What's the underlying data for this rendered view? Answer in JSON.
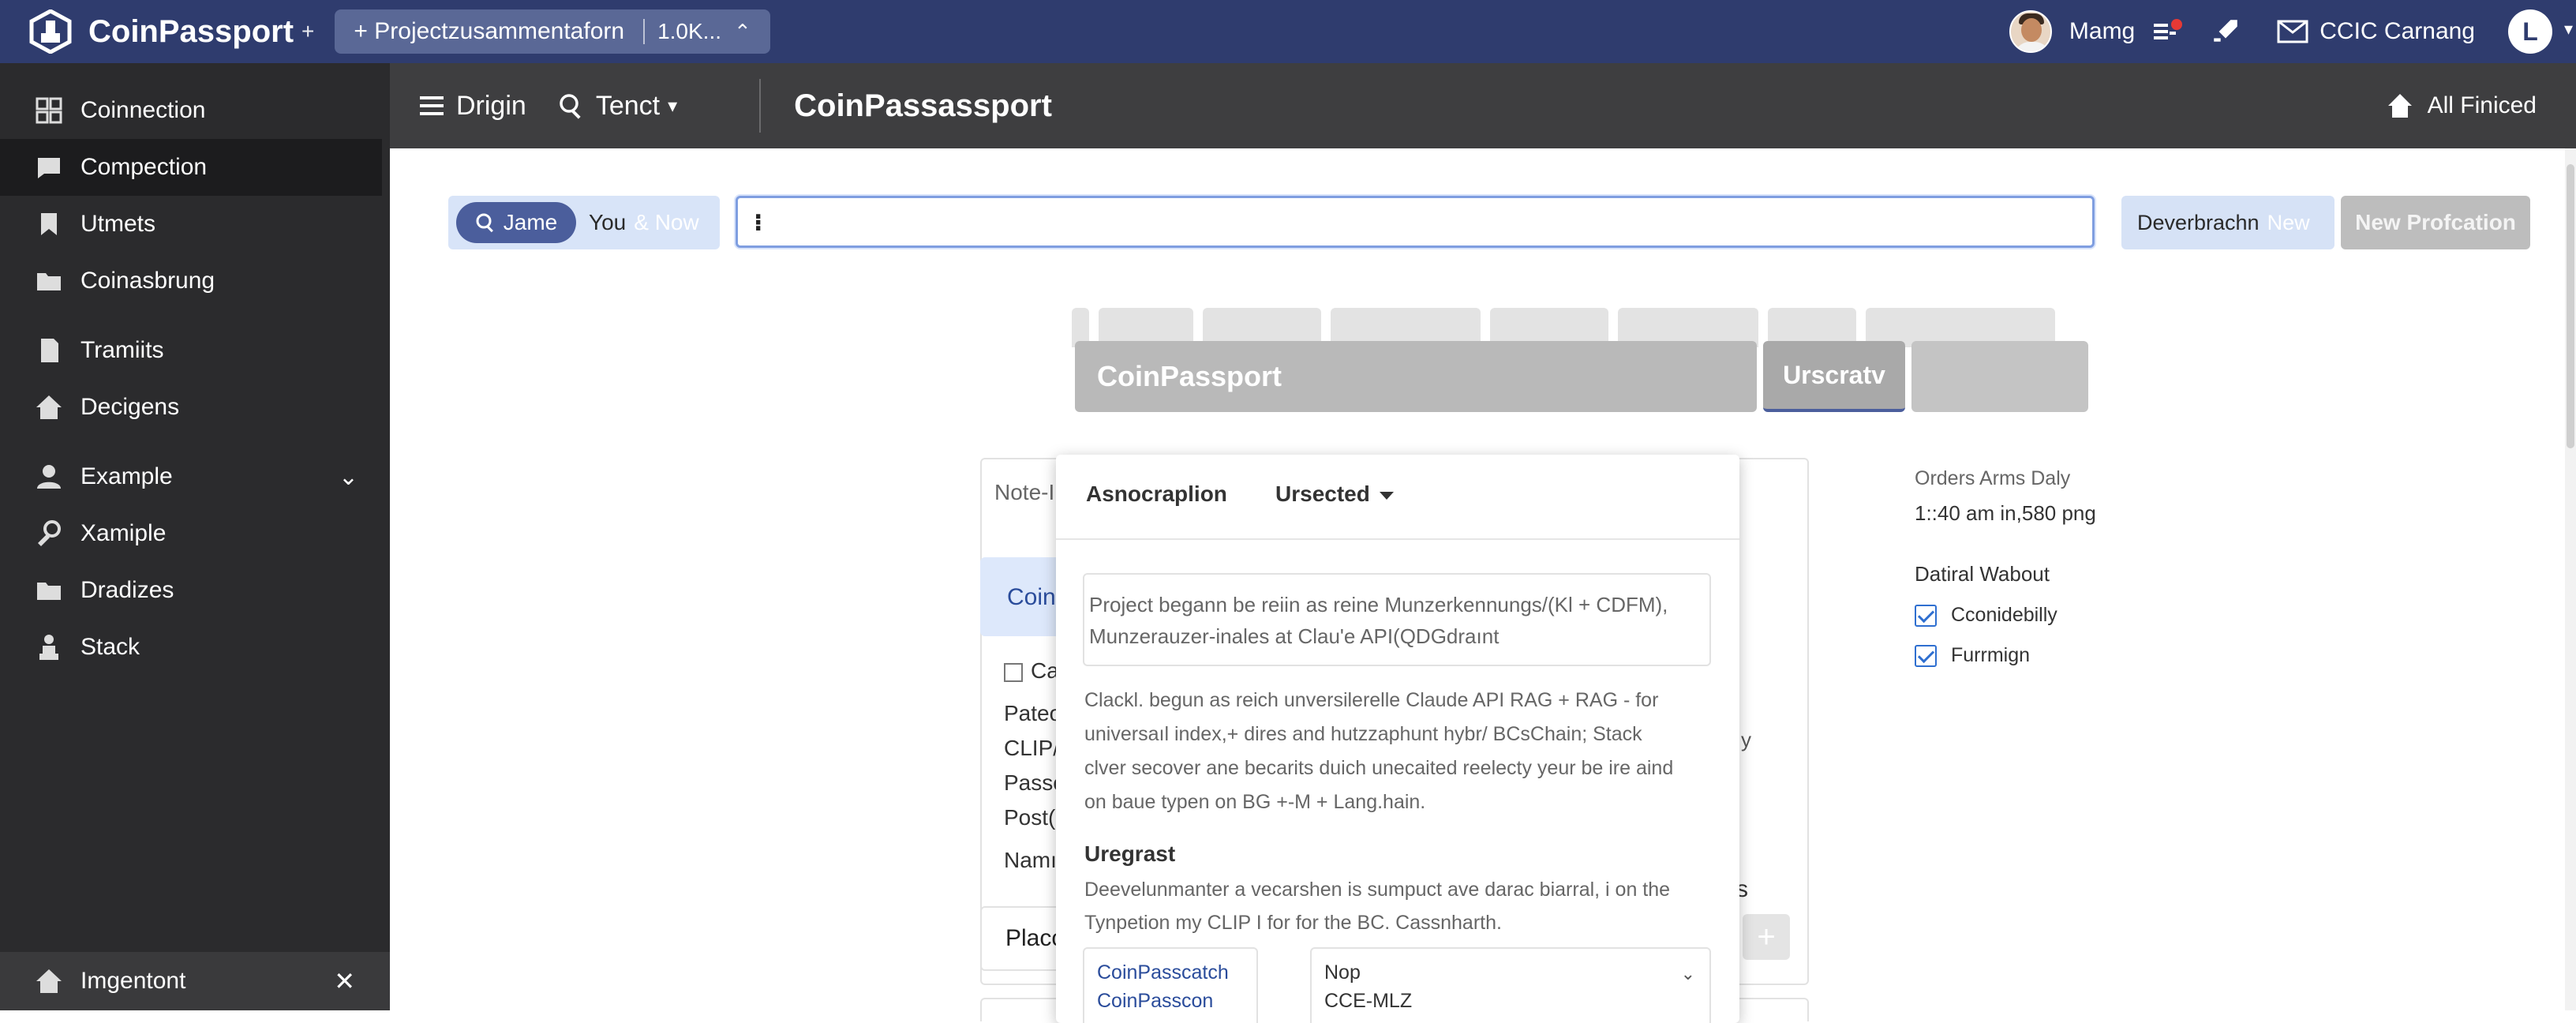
{
  "topbar": {
    "app_name": "CoinPassport",
    "plus": "+",
    "project_tab": "+ Projectzusammentaforn",
    "project_count": "1.0K...",
    "project_close": "⌃",
    "user_name": "Mamg",
    "mail_label": "CCIC Carnang",
    "user_initial": "L"
  },
  "sidebar": {
    "items": [
      {
        "label": "Coinnection",
        "icon": "grid-icon"
      },
      {
        "label": "Compection",
        "icon": "chat-icon"
      },
      {
        "label": "Utmets",
        "icon": "bookmark-icon"
      },
      {
        "label": "Coinasbrung",
        "icon": "folder-icon"
      },
      {
        "label": "Tramiits",
        "icon": "document-icon"
      },
      {
        "label": "Decigens",
        "icon": "home-icon"
      },
      {
        "label": "Example",
        "icon": "user-icon"
      },
      {
        "label": "Xamiple",
        "icon": "key-icon"
      },
      {
        "label": "Dradizes",
        "icon": "folder-icon"
      },
      {
        "label": "Stack",
        "icon": "stack-icon"
      }
    ],
    "bottom_label": "Imgentont",
    "bottom_close": "✕"
  },
  "toolbar": {
    "menu_label": "Drigin",
    "search_label": "Tenct",
    "title": "CoinPassassport",
    "right_label": "All Finiced"
  },
  "main": {
    "seg_pill": "Jame",
    "seg_you": "You",
    "seg_now": "& Now",
    "search_value": "⁝",
    "btn_dev": "Deverbrachn",
    "btn_dev_new": "New",
    "btn_new_prof": "New Profcation",
    "modal_title": "CoinPassport",
    "modal_tab": "Urscratv",
    "behind_note": "Note-I",
    "behind_coin": "Coin",
    "behind_lines": [
      "Ca",
      "Pateo",
      "CLIP/",
      "Passo",
      "Post(",
      "Namı"
    ],
    "placc": "Placc",
    "side_s": "s",
    "side_y": "y",
    "side_plus": "+"
  },
  "popup": {
    "head_left": "Asnocraplion",
    "head_right": "Ursected",
    "textarea_lines": [
      "Project begann be reiin as reine Munzerkennungs/(Kl + CDFM),",
      "Munzerauzer-inales at Clau'e API(QDGdraınt"
    ],
    "para_lines": [
      "Clackl. begun as reich unversilerelle Claude API  RAG + RAG - for",
      "universaıl index,+ dires and hutzzaphunt hybr/ BCsChain; Stack",
      "clver secover ane becarits duich unecaited reelecty yeur be ire aind",
      "on baue typen on BG +-M + Lang.hain."
    ],
    "u_head": "Uregrast",
    "u_lines": [
      "Deevelunmanter a vecarshen is sumpuct ave darac biarral, i on the",
      "Tynpetion my CLIP I for for the BC. Cassnharth."
    ],
    "lbox_lines": [
      "CoinPasscatch",
      "CoinPasscon"
    ],
    "rbox_lines": [
      "Nop",
      "CCE-MLZ"
    ]
  },
  "right_panel": {
    "label": "Orders Arms Daly",
    "value": "1::40 am in,580 png",
    "head": "Datiral Wabout",
    "checks": [
      "Cconidebilly",
      "Furrmign"
    ]
  }
}
